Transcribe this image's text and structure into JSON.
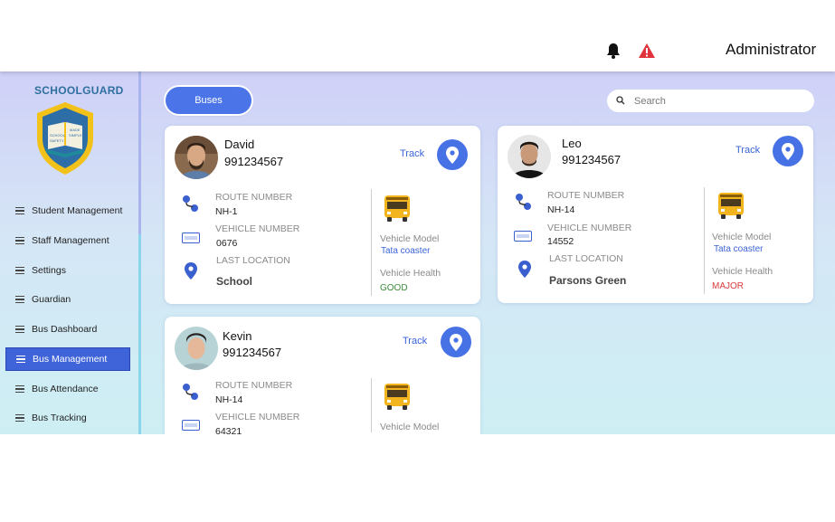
{
  "header": {
    "user": "Administrator",
    "bell_icon": "bell-icon",
    "warning_icon": "warning-icon",
    "warning_color": "#e0333b"
  },
  "sidebar": {
    "brand": "SCHOOLGUARD",
    "logo_text": [
      "SCHOOL",
      "MADE",
      "SAFETY",
      "SIMPLE"
    ],
    "items": [
      {
        "label": "Student Management"
      },
      {
        "label": "Staff Management"
      },
      {
        "label": "Settings"
      },
      {
        "label": "Guardian"
      },
      {
        "label": "Bus Dashboard"
      },
      {
        "label": "Bus Management",
        "active": true
      },
      {
        "label": "Bus Attendance"
      },
      {
        "label": "Bus Tracking"
      }
    ]
  },
  "main": {
    "tab": "Buses",
    "search_placeholder": "Search",
    "labels": {
      "route": "ROUTE NUMBER",
      "vehicle": "VEHICLE NUMBER",
      "location": "LAST LOCATION",
      "model": "Vehicle Model",
      "health": "Vehicle Health",
      "track": "Track"
    },
    "buses": [
      {
        "name": "David",
        "phone": "991234567",
        "route": "NH-1",
        "vehicle": "0676",
        "location": "School",
        "model": "Tata coaster",
        "health": "GOOD"
      },
      {
        "name": "Leo",
        "phone": "991234567",
        "route": "NH-14",
        "vehicle": "14552",
        "location": "Parsons Green",
        "model": "Tata coaster",
        "health": "MAJOR"
      },
      {
        "name": "Kevin",
        "phone": "991234567",
        "route": "NH-14",
        "vehicle": "64321"
      }
    ]
  },
  "colors": {
    "accent": "#4772e6",
    "active_nav": "#3f63d9",
    "good": "#3b8a3b",
    "major": "#d93a3a"
  }
}
